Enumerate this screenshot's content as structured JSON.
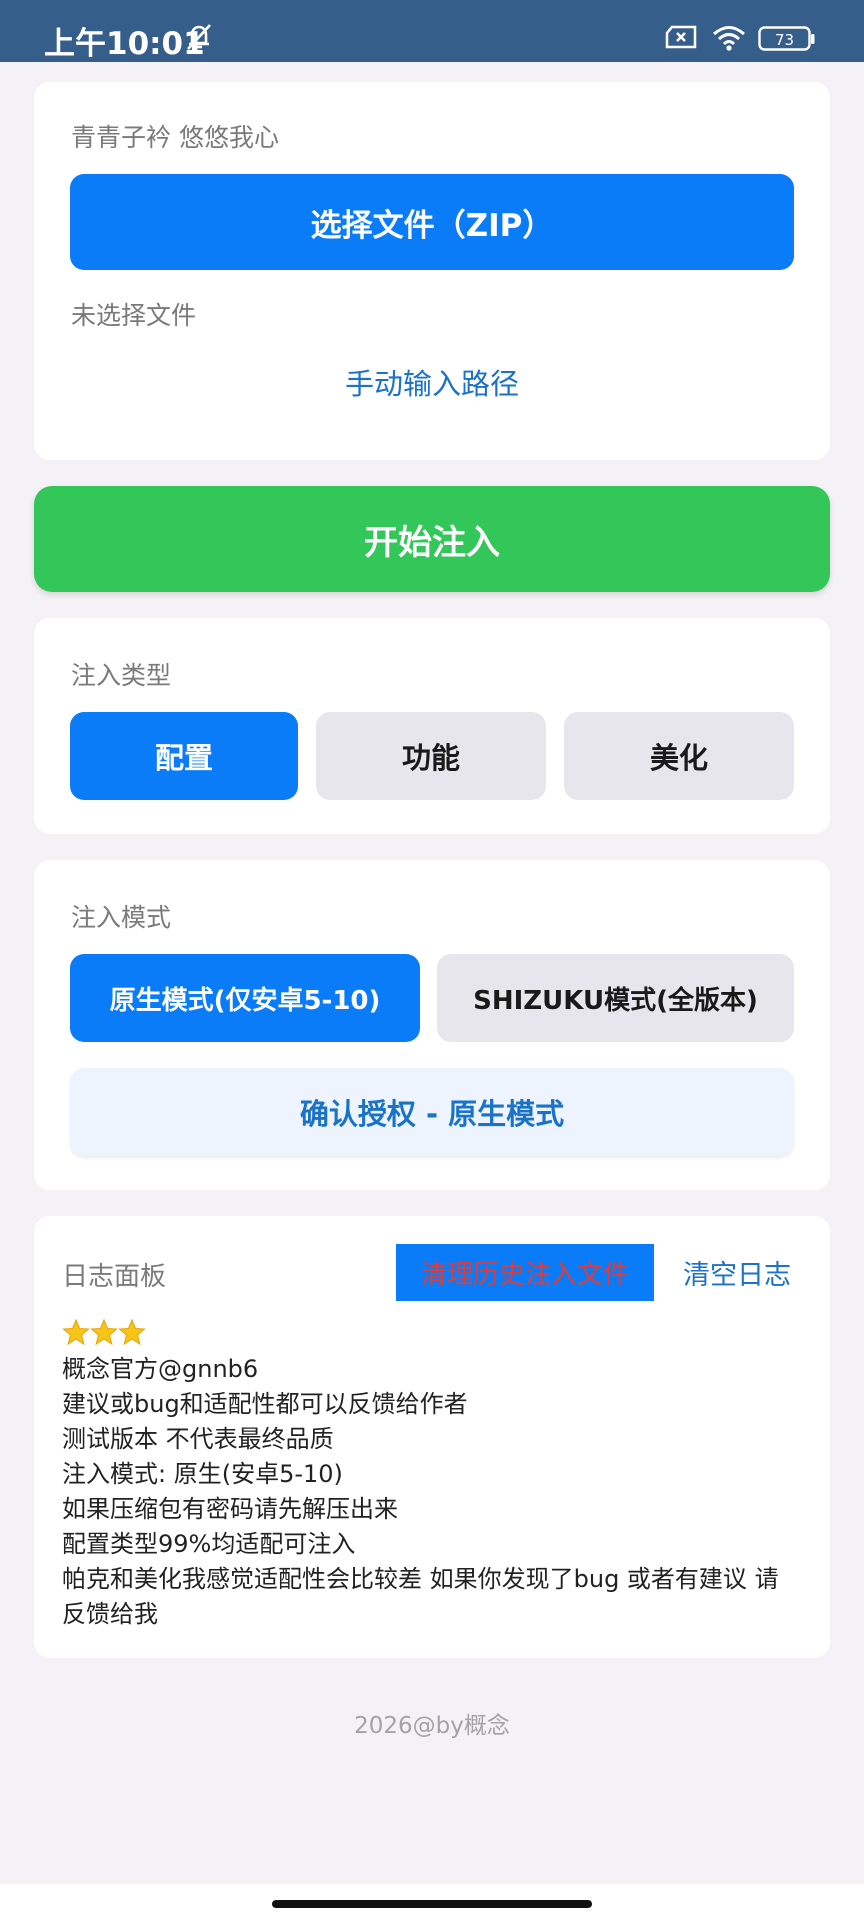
{
  "status_bar": {
    "time": "上午10:01",
    "battery": "73",
    "icons": [
      "bell-off-icon",
      "sim-x-icon",
      "wifi-icon",
      "battery-icon"
    ]
  },
  "file_card": {
    "subtitle": "青青子衿 悠悠我心",
    "choose_button": "选择文件（ZIP）",
    "no_file_text": "未选择文件",
    "manual_path_link": "手动输入路径"
  },
  "start_button": "开始注入",
  "inject_type": {
    "label": "注入类型",
    "options": [
      "配置",
      "功能",
      "美化"
    ],
    "selected": "配置"
  },
  "inject_mode": {
    "label": "注入模式",
    "options": [
      "原生模式(仅安卓5-10)",
      "SHIZUKU模式(全版本)"
    ],
    "selected": "原生模式(仅安卓5-10)",
    "confirm_button": "确认授权 - 原生模式"
  },
  "log_panel": {
    "title": "日志面板",
    "clear_history_button": "清理历史注入文件",
    "clear_log_button": "清空日志",
    "lines": [
      "概念官方@gnnb6",
      "建议或bug和适配性都可以反馈给作者",
      "测试版本  不代表最终品质",
      "注入模式: 原生(安卓5-10)",
      "如果压缩包有密码请先解压出来",
      "配置类型99%均适配可注入",
      "帕克和美化我感觉适配性会比较差  如果你发现了bug  或者有建议  请",
      "反馈给我"
    ],
    "star_icons": [
      "star-icon",
      "star-icon",
      "star-icon"
    ]
  },
  "footer": "2026@by概念",
  "colors": {
    "status_bar": "#365e8b",
    "primary_blue": "#0a7cf7",
    "green": "#33c759",
    "link_blue": "#1a73c8",
    "danger_red": "#e53935",
    "background": "#f4f2f7"
  }
}
